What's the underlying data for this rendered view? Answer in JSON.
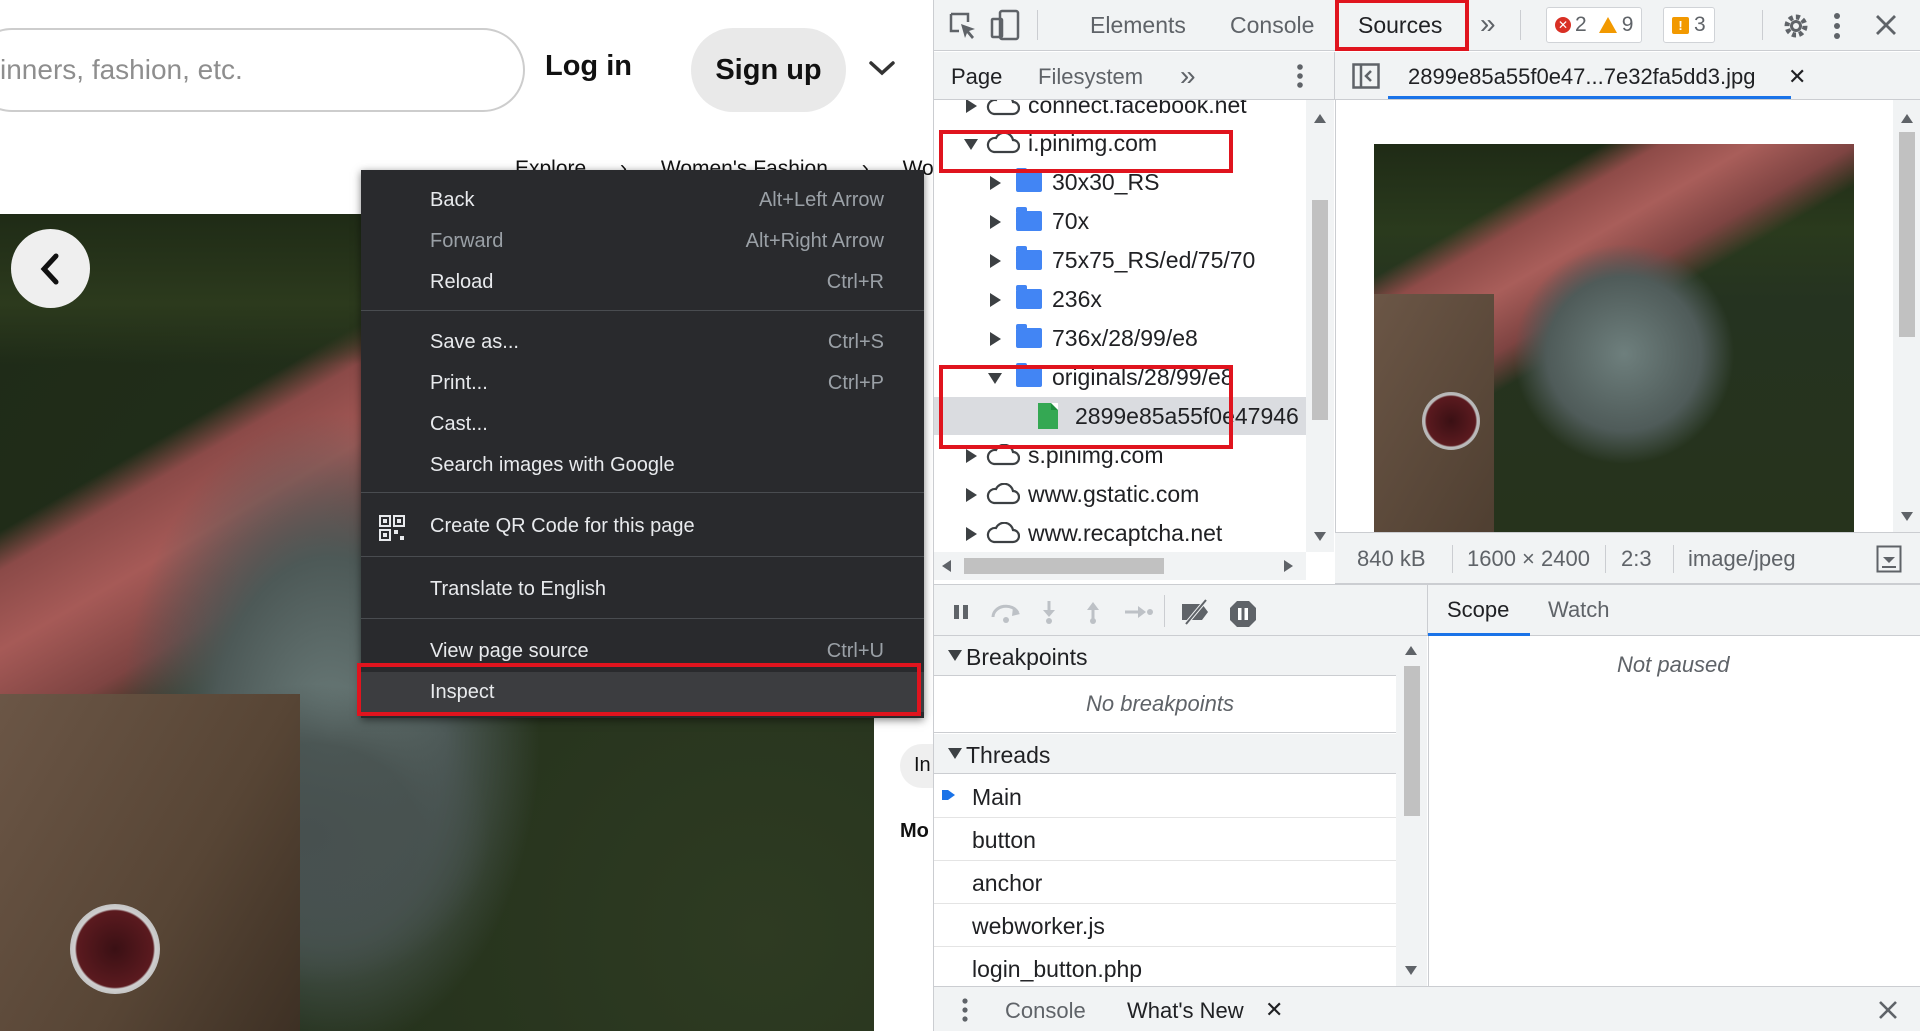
{
  "web_page": {
    "search_placeholder": "inners, fashion, etc.",
    "login_label": "Log in",
    "signup_label": "Sign up",
    "breadcrumb": [
      "Explore",
      "Women's Fashion",
      "Womer"
    ],
    "edge_text_in": "In",
    "edge_text_mo": "Mo"
  },
  "context_menu": {
    "items": [
      {
        "label": "Back",
        "shortcut": "Alt+Left Arrow",
        "disabled": false
      },
      {
        "label": "Forward",
        "shortcut": "Alt+Right Arrow",
        "disabled": true
      },
      {
        "label": "Reload",
        "shortcut": "Ctrl+R",
        "disabled": false
      },
      {
        "label": "Save as...",
        "shortcut": "Ctrl+S",
        "disabled": false
      },
      {
        "label": "Print...",
        "shortcut": "Ctrl+P",
        "disabled": false
      },
      {
        "label": "Cast...",
        "shortcut": "",
        "disabled": false
      },
      {
        "label": "Search images with Google",
        "shortcut": "",
        "disabled": false
      },
      {
        "label": "Create QR Code for this page",
        "shortcut": "",
        "disabled": false
      },
      {
        "label": "Translate to English",
        "shortcut": "",
        "disabled": false
      },
      {
        "label": "View page source",
        "shortcut": "Ctrl+U",
        "disabled": false
      },
      {
        "label": "Inspect",
        "shortcut": "",
        "disabled": false
      }
    ]
  },
  "devtools": {
    "tabs": [
      "Elements",
      "Console",
      "Sources"
    ],
    "active_tab": "Sources",
    "more_tabs": "»",
    "errors_count": "2",
    "warnings_count": "9",
    "issues_count": "3",
    "sub_tabs": [
      "Page",
      "Filesystem"
    ],
    "open_file": "2899e85a55f0e47...7e32fa5dd3.jpg",
    "tree": [
      {
        "label": "connect.facebook.net",
        "type": "domain",
        "expanded": false,
        "depth": 0
      },
      {
        "label": "i.pinimg.com",
        "type": "domain",
        "expanded": true,
        "depth": 0
      },
      {
        "label": "30x30_RS",
        "type": "folder",
        "expanded": false,
        "depth": 1
      },
      {
        "label": "70x",
        "type": "folder",
        "expanded": false,
        "depth": 1
      },
      {
        "label": "75x75_RS/ed/75/70",
        "type": "folder",
        "expanded": false,
        "depth": 1
      },
      {
        "label": "236x",
        "type": "folder",
        "expanded": false,
        "depth": 1
      },
      {
        "label": "736x/28/99/e8",
        "type": "folder",
        "expanded": false,
        "depth": 1
      },
      {
        "label": "originals/28/99/e8",
        "type": "folder",
        "expanded": true,
        "depth": 1
      },
      {
        "label": "2899e85a55f0e47946",
        "type": "file",
        "expanded": false,
        "depth": 2
      },
      {
        "label": "s.pinimg.com",
        "type": "domain",
        "expanded": false,
        "depth": 0
      },
      {
        "label": "www.gstatic.com",
        "type": "domain",
        "expanded": false,
        "depth": 0
      },
      {
        "label": "www.recaptcha.net",
        "type": "domain",
        "expanded": false,
        "depth": 0
      }
    ],
    "image_info": {
      "size": "840 kB",
      "dimensions": "1600 × 2400",
      "ratio": "2:3",
      "mime": "image/jpeg"
    },
    "right_tabs": [
      "Scope",
      "Watch"
    ],
    "not_paused": "Not paused",
    "breakpoints_header": "Breakpoints",
    "no_breakpoints": "No breakpoints",
    "threads_header": "Threads",
    "threads": [
      "Main",
      "button",
      "anchor",
      "webworker.js",
      "login_button.php"
    ],
    "drawer_tabs": [
      "Console",
      "What's New"
    ]
  },
  "colors": {
    "highlight": "#e0141e",
    "accent": "#1a73e8",
    "menu_bg": "#292a2d"
  }
}
